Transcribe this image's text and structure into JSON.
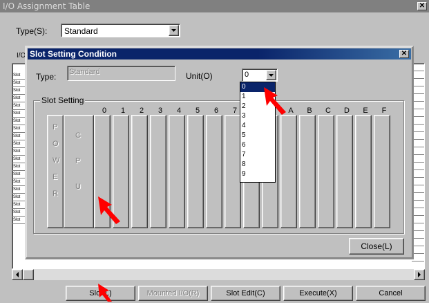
{
  "main": {
    "title": "I/O Assignment Table",
    "type_label": "Type(S):",
    "type_value": "Standard",
    "truncated_label": "I/O",
    "row_labels": [
      "Slot",
      "Slot",
      "Slot",
      "Slot",
      "Slot",
      "Slot",
      "Slot",
      "Slot",
      "Slot",
      "Slot",
      "Slot",
      "Slot",
      "Slot",
      "Slot",
      "Slot",
      "Slot",
      "Slot",
      "Slot",
      "Slot",
      "Slot"
    ],
    "buttons": {
      "slot": "Slot(L)",
      "mounted": "Mounted I/O(R)",
      "slot_edit": "Slot Edit(C)",
      "execute": "Execute(X)",
      "cancel": "Cancel"
    }
  },
  "dialog": {
    "title": "Slot Setting Condition",
    "type_label": "Type:",
    "type_value": "Standard",
    "unit_label": "Unit(O)",
    "unit_value": "0",
    "unit_options": [
      "0",
      "1",
      "2",
      "3",
      "4",
      "5",
      "6",
      "7",
      "8",
      "9"
    ],
    "slot_group_label": "Slot Setting",
    "slot_numbers": [
      "0",
      "1",
      "2",
      "3",
      "4",
      "5",
      "6",
      "7",
      "8",
      "9",
      "A",
      "B",
      "C",
      "D",
      "E",
      "F"
    ],
    "power_letters": [
      "P",
      "O",
      "W",
      "E",
      "R"
    ],
    "cpu_letters": [
      "C",
      "P",
      "U"
    ],
    "close_label": "Close(L)"
  },
  "colors": {
    "face": "#c0c0c0",
    "active_title": "#0a246a",
    "highlight": "#0a246a",
    "arrow": "#ff0000"
  },
  "icons": {
    "close": "close-icon",
    "dropdown": "chevron-down-icon",
    "scroll_left": "arrow-left-icon",
    "scroll_right": "arrow-right-icon",
    "pointer": "red-arrow-icon"
  }
}
